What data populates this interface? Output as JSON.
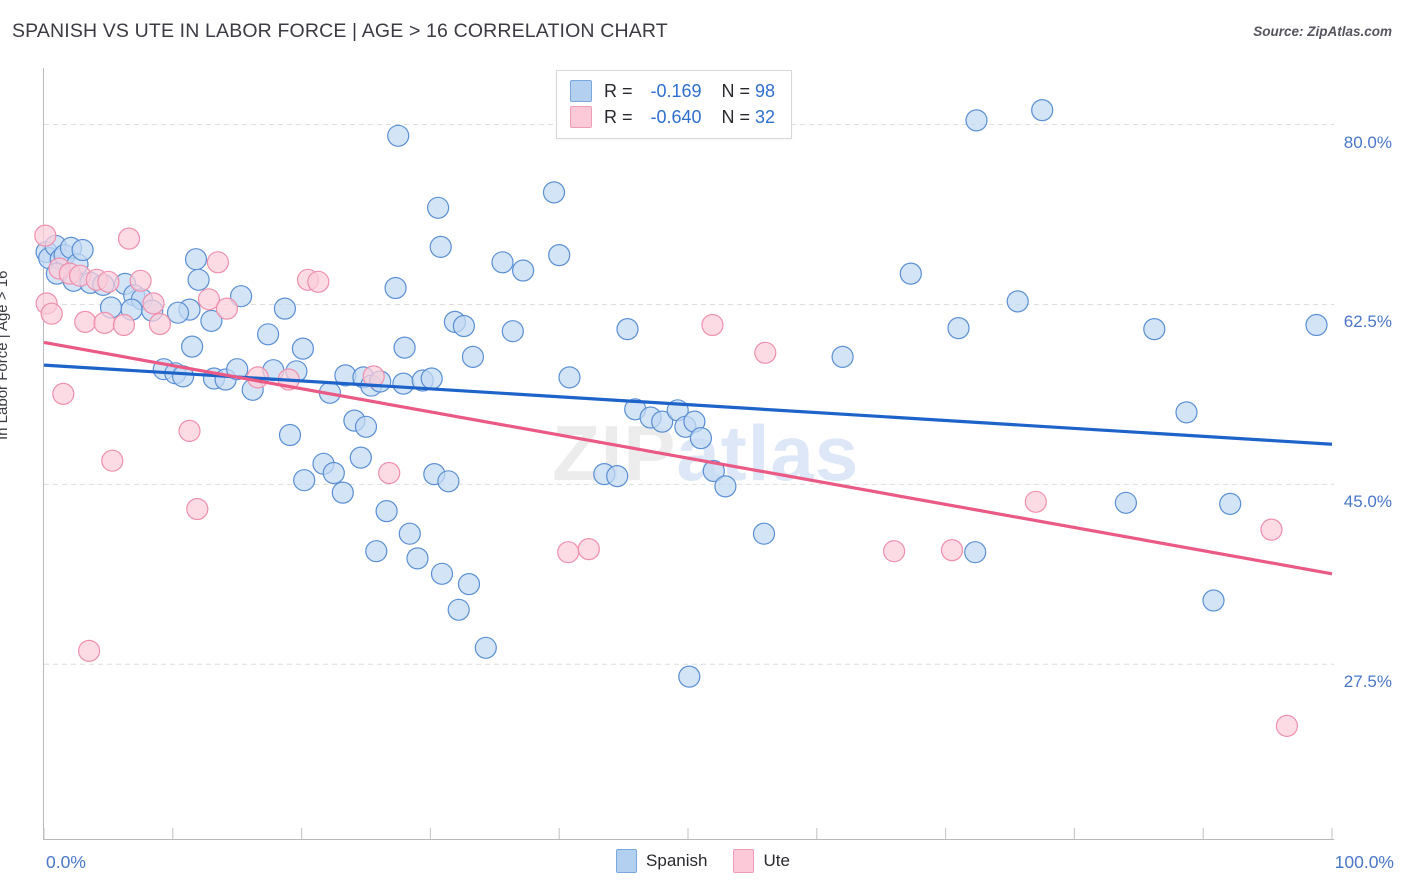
{
  "header": {
    "title": "SPANISH VS UTE IN LABOR FORCE | AGE > 16 CORRELATION CHART",
    "source": "Source: ZipAtlas.com"
  },
  "watermark": {
    "part1": "ZIP",
    "part2": "atlas"
  },
  "stats_legend": {
    "rows": [
      {
        "series": "Spanish",
        "r_label": "R =",
        "r_value": "-0.169",
        "n_label": "N =",
        "n_value": "98",
        "color": "#b4d0f0"
      },
      {
        "series": "Ute",
        "r_label": "R =",
        "r_value": "-0.640",
        "n_label": "N =",
        "n_value": "32",
        "color": "#fbc9d8"
      }
    ]
  },
  "series_legend": [
    {
      "label": "Spanish",
      "color": "#b4d0f0"
    },
    {
      "label": "Ute",
      "color": "#fbc9d8"
    }
  ],
  "axes": {
    "y_title": "In Labor Force | Age > 16",
    "y_ticks": [
      "80.0%",
      "62.5%",
      "45.0%",
      "27.5%"
    ],
    "x_min_label": "0.0%",
    "x_max_label": "100.0%"
  },
  "chart_data": {
    "type": "scatter",
    "title": "SPANISH VS UTE IN LABOR FORCE | AGE > 16 CORRELATION CHART",
    "xlabel": "",
    "ylabel": "In Labor Force | Age > 16",
    "xlim": [
      0,
      100
    ],
    "ylim": [
      10.5,
      85.5
    ],
    "xtick_labels": [
      "0.0%",
      "100.0%"
    ],
    "ytick_values": [
      80.0,
      62.5,
      45.0,
      27.5
    ],
    "ytick_labels": [
      "80.0%",
      "62.5%",
      "45.0%",
      "27.5%"
    ],
    "grid": "horizontal-dashed",
    "legend_position": "bottom-center",
    "colors": {
      "spanish": "#b4d0f0",
      "ute": "#fbc9d8",
      "spanish_line": "#1d63c9",
      "ute_line": "#ea5a84"
    },
    "series": [
      {
        "name": "Spanish",
        "R": -0.169,
        "N": 98,
        "marker_color": "#c3daf4",
        "marker_edge": "#5a8fd4",
        "trendline": {
          "x0": 0,
          "y0": 56.6,
          "x1": 100,
          "y1": 48.9,
          "color": "#1d63c9"
        },
        "points": [
          [
            0.2,
            67.6
          ],
          [
            0.4,
            67.0
          ],
          [
            0.9,
            68.2
          ],
          [
            1.3,
            66.9
          ],
          [
            1.6,
            67.3
          ],
          [
            2.1,
            68.0
          ],
          [
            2.6,
            66.4
          ],
          [
            3.0,
            67.8
          ],
          [
            1.0,
            65.5
          ],
          [
            2.3,
            64.8
          ],
          [
            3.6,
            64.6
          ],
          [
            4.6,
            64.4
          ],
          [
            6.3,
            64.5
          ],
          [
            7.0,
            63.4
          ],
          [
            7.6,
            63.0
          ],
          [
            5.2,
            62.2
          ],
          [
            6.8,
            62.0
          ],
          [
            8.4,
            61.9
          ],
          [
            11.3,
            62.0
          ],
          [
            11.8,
            66.9
          ],
          [
            12.0,
            64.9
          ],
          [
            10.4,
            61.7
          ],
          [
            13.0,
            60.9
          ],
          [
            15.3,
            63.3
          ],
          [
            11.5,
            58.4
          ],
          [
            9.3,
            56.2
          ],
          [
            10.2,
            55.8
          ],
          [
            10.8,
            55.5
          ],
          [
            13.2,
            55.3
          ],
          [
            14.1,
            55.2
          ],
          [
            15.0,
            56.2
          ],
          [
            17.4,
            59.6
          ],
          [
            18.7,
            62.1
          ],
          [
            17.8,
            56.1
          ],
          [
            19.6,
            56.0
          ],
          [
            16.2,
            54.2
          ],
          [
            20.1,
            58.2
          ],
          [
            22.2,
            53.9
          ],
          [
            23.4,
            55.6
          ],
          [
            24.8,
            55.4
          ],
          [
            25.4,
            54.6
          ],
          [
            26.1,
            55.0
          ],
          [
            24.1,
            51.2
          ],
          [
            25.0,
            50.6
          ],
          [
            19.1,
            49.8
          ],
          [
            21.7,
            47.0
          ],
          [
            22.5,
            46.1
          ],
          [
            20.2,
            45.4
          ],
          [
            23.2,
            44.2
          ],
          [
            27.5,
            78.9
          ],
          [
            27.3,
            64.1
          ],
          [
            27.9,
            54.8
          ],
          [
            24.6,
            47.6
          ],
          [
            26.6,
            42.4
          ],
          [
            25.8,
            38.5
          ],
          [
            28.0,
            58.3
          ],
          [
            29.4,
            55.1
          ],
          [
            30.1,
            55.3
          ],
          [
            30.6,
            71.9
          ],
          [
            30.8,
            68.1
          ],
          [
            31.9,
            60.8
          ],
          [
            32.6,
            60.4
          ],
          [
            33.3,
            57.4
          ],
          [
            30.3,
            46.0
          ],
          [
            31.4,
            45.3
          ],
          [
            28.4,
            40.2
          ],
          [
            29.0,
            37.8
          ],
          [
            30.9,
            36.3
          ],
          [
            33.0,
            35.3
          ],
          [
            32.2,
            32.8
          ],
          [
            34.3,
            29.1
          ],
          [
            35.6,
            66.6
          ],
          [
            36.4,
            59.9
          ],
          [
            37.2,
            65.8
          ],
          [
            39.6,
            73.4
          ],
          [
            40.0,
            67.3
          ],
          [
            40.8,
            55.4
          ],
          [
            43.5,
            46.0
          ],
          [
            44.5,
            45.8
          ],
          [
            45.3,
            60.1
          ],
          [
            45.9,
            52.3
          ],
          [
            47.1,
            51.5
          ],
          [
            48.0,
            51.1
          ],
          [
            49.2,
            52.2
          ],
          [
            49.8,
            50.6
          ],
          [
            50.5,
            51.1
          ],
          [
            51.0,
            49.5
          ],
          [
            52.0,
            46.3
          ],
          [
            52.9,
            44.8
          ],
          [
            50.1,
            26.3
          ],
          [
            55.9,
            40.2
          ],
          [
            62.0,
            57.4
          ],
          [
            67.3,
            65.5
          ],
          [
            71.0,
            60.2
          ],
          [
            72.4,
            80.4
          ],
          [
            75.6,
            62.8
          ],
          [
            77.5,
            81.4
          ],
          [
            84.0,
            43.2
          ],
          [
            86.2,
            60.1
          ],
          [
            88.7,
            52.0
          ],
          [
            92.1,
            43.1
          ],
          [
            90.8,
            33.7
          ],
          [
            98.8,
            60.5
          ],
          [
            72.3,
            38.4
          ]
        ]
      },
      {
        "name": "Ute",
        "R": -0.64,
        "N": 32,
        "marker_color": "#fbcdda",
        "marker_edge": "#ef8fad",
        "trendline": {
          "x0": 0,
          "y0": 58.8,
          "x1": 100,
          "y1": 36.3,
          "color": "#ea5a84"
        },
        "points": [
          [
            0.1,
            69.2
          ],
          [
            0.2,
            62.6
          ],
          [
            0.6,
            61.6
          ],
          [
            1.2,
            66.0
          ],
          [
            2.0,
            65.5
          ],
          [
            2.8,
            65.3
          ],
          [
            4.1,
            64.9
          ],
          [
            5.0,
            64.7
          ],
          [
            3.2,
            60.8
          ],
          [
            4.7,
            60.7
          ],
          [
            6.2,
            60.5
          ],
          [
            1.5,
            53.8
          ],
          [
            5.3,
            47.3
          ],
          [
            6.6,
            68.9
          ],
          [
            7.5,
            64.8
          ],
          [
            8.5,
            62.6
          ],
          [
            9.0,
            60.6
          ],
          [
            11.3,
            50.2
          ],
          [
            11.9,
            42.6
          ],
          [
            12.8,
            63.0
          ],
          [
            13.5,
            66.6
          ],
          [
            14.2,
            62.1
          ],
          [
            16.6,
            55.4
          ],
          [
            19.0,
            55.2
          ],
          [
            20.5,
            64.9
          ],
          [
            21.3,
            64.7
          ],
          [
            25.6,
            55.5
          ],
          [
            26.8,
            46.1
          ],
          [
            3.5,
            28.8
          ],
          [
            40.7,
            38.4
          ],
          [
            42.3,
            38.7
          ],
          [
            51.9,
            60.5
          ],
          [
            56.0,
            57.8
          ],
          [
            66.0,
            38.5
          ],
          [
            70.5,
            38.6
          ],
          [
            77.0,
            43.3
          ],
          [
            95.3,
            40.6
          ],
          [
            96.5,
            21.5
          ]
        ]
      }
    ]
  }
}
